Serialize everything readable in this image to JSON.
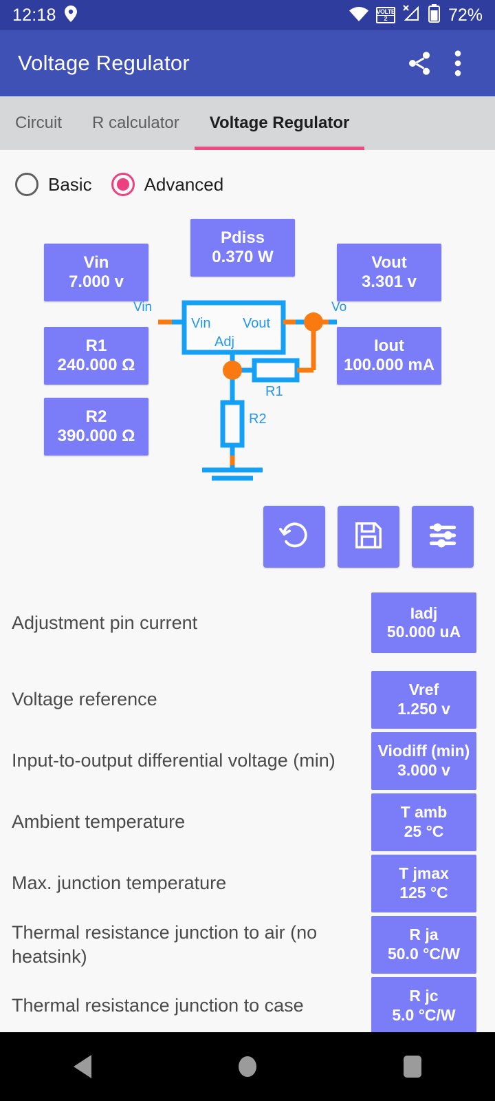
{
  "status_bar": {
    "time": "12:18",
    "location_icon": "location-pin-icon",
    "wifi_icon": "wifi-icon",
    "volte_label_top": "VOLTE",
    "volte_label_bottom": "2",
    "signal_icon": "signal-no-service-icon",
    "battery_icon": "battery-icon",
    "battery_text": "72%"
  },
  "app_bar": {
    "title": "Voltage Regulator",
    "share_icon": "share-icon",
    "overflow_icon": "more-vertical-icon"
  },
  "tabs": [
    {
      "label": "Circuit",
      "active": false
    },
    {
      "label": "R calculator",
      "active": false
    },
    {
      "label": "Voltage Regulator",
      "active": true
    }
  ],
  "mode": {
    "options": [
      {
        "label": "Basic",
        "selected": false
      },
      {
        "label": "Advanced",
        "selected": true
      }
    ]
  },
  "diagram": {
    "boxes": {
      "vin": {
        "key": "Vin",
        "value": "7.000 v"
      },
      "pdiss": {
        "key": "Pdiss",
        "value": "0.370 W"
      },
      "vout": {
        "key": "Vout",
        "value": "3.301 v"
      },
      "r1": {
        "key": "R1",
        "value": "240.000 Ω"
      },
      "iout": {
        "key": "Iout",
        "value": "100.000 mA"
      },
      "r2": {
        "key": "R2",
        "value": "390.000 Ω"
      }
    },
    "schematic": {
      "node_vin": "Vin",
      "node_vo": "Vo",
      "pin_vin": "Vin",
      "pin_vout": "Vout",
      "pin_adj": "Adj",
      "res_r1": "R1",
      "res_r2": "R2"
    }
  },
  "actions": [
    {
      "name": "reset-button",
      "icon": "restore-rotate-left-icon"
    },
    {
      "name": "save-button",
      "icon": "floppy-disk-save-icon"
    },
    {
      "name": "settings-button",
      "icon": "sliders-settings-icon"
    }
  ],
  "parameters": [
    {
      "label": "Adjustment pin current",
      "key": "Iadj",
      "value": "50.000 uA"
    },
    {
      "label": "Voltage reference",
      "key": "Vref",
      "value": "1.250 v"
    },
    {
      "label": "Input-to-output differential voltage (min)",
      "key": "Viodiff (min)",
      "value": "3.000 v"
    },
    {
      "label": "Ambient temperature",
      "key": "T amb",
      "value": "25 °C"
    },
    {
      "label": "Max. junction temperature",
      "key": "T jmax",
      "value": "125 °C"
    },
    {
      "label": "Thermal resistance junction to air (no heatsink)",
      "key": "R ja",
      "value": "50.0 °C/W"
    },
    {
      "label": "Thermal resistance junction to case",
      "key": "R jc",
      "value": "5.0 °C/W"
    }
  ],
  "nav_bar": {
    "back_icon": "nav-back-icon",
    "home_icon": "nav-home-icon",
    "recents_icon": "nav-recents-icon"
  },
  "colors": {
    "status_bar": "#2f3e9e",
    "app_bar": "#3f51b5",
    "tab_bar": "#d6d7d9",
    "tab_indicator": "#ec4b82",
    "accent_pink": "#ec4080",
    "value_box": "#7b7df8",
    "wire_blue": "#14a0f5",
    "node_orange": "#f97a10",
    "page_bg": "#f8f8f9"
  }
}
